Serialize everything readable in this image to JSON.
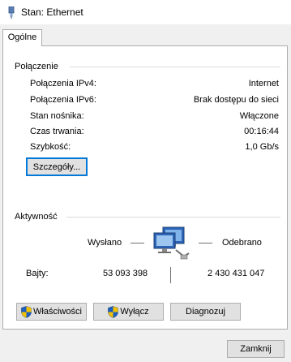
{
  "window": {
    "title": "Stan: Ethernet",
    "tab_label": "Ogólne"
  },
  "connection": {
    "group_title": "Połączenie",
    "rows": [
      {
        "label": "Połączenia IPv4:",
        "value": "Internet"
      },
      {
        "label": "Połączenia IPv6:",
        "value": "Brak dostępu do sieci"
      },
      {
        "label": "Stan nośnika:",
        "value": "Włączone"
      },
      {
        "label": "Czas trwania:",
        "value": "00:16:44"
      },
      {
        "label": "Szybkość:",
        "value": "1,0 Gb/s"
      }
    ],
    "details_button": "Szczegóły..."
  },
  "activity": {
    "group_title": "Aktywność",
    "sent_label": "Wysłano",
    "received_label": "Odebrano",
    "bytes_label": "Bajty:",
    "bytes_sent": "53 093 398",
    "bytes_received": "2 430 431 047",
    "icon": "network-computers-icon"
  },
  "actions": {
    "properties_button": "Właściwości",
    "disable_button": "Wyłącz",
    "diagnose_button": "Diagnozuj",
    "close_button": "Zamknij"
  },
  "colors": {
    "focus_border": "#0078d7",
    "button_face": "#e1e1e1",
    "window_background": "#f0f0f0"
  }
}
